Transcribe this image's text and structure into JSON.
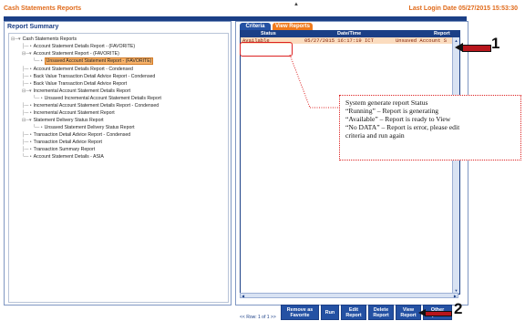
{
  "header": {
    "title": "Cash Statements Reports",
    "last_login": "Last Login Date 05/27/2015 15:53:30"
  },
  "report_summary": {
    "title": "Report Summary",
    "tree": [
      {
        "label": "Cash Statements Reports"
      },
      {
        "label": "Account Statement Details Report - (FAVORITE)"
      },
      {
        "label": "Account Statement Report - (FAVORITE)"
      },
      {
        "label": "Unsaved Account Statement Report - (FAVORITE)",
        "selected": true
      },
      {
        "label": "Account Statement Details Report - Condensed"
      },
      {
        "label": "Back Value Transaction Detail Advice Report - Condensed"
      },
      {
        "label": "Back Value Transaction Detail Advice Report"
      },
      {
        "label": "Incremental Account Statement Details Report"
      },
      {
        "label": "Unsaved Incremental Account Statement Details Report"
      },
      {
        "label": "Incremental Account Statement Details Report - Condensed"
      },
      {
        "label": "Incremental Account Statement Report"
      },
      {
        "label": "Statement Delivery Status Report"
      },
      {
        "label": "Unsaved Statement Delivery Status Report"
      },
      {
        "label": "Transaction Detail Advice Report - Condensed"
      },
      {
        "label": "Transaction Detail Advice Report"
      },
      {
        "label": "Transaction Summary Report"
      },
      {
        "label": "Account Statement Details - ASIA"
      }
    ]
  },
  "tabs": {
    "criteria": "Criteria",
    "view_reports": "View Reports"
  },
  "grid": {
    "columns": [
      "Status",
      "Date/Time",
      "Report"
    ],
    "rows": [
      {
        "status": "Available",
        "datetime": "05/27/2015 16:17:19 ICT",
        "report": "Unsaved Account S"
      }
    ],
    "row_count": "<< Row: 1 of 1 >>"
  },
  "annotation": {
    "lines": [
      "System generate report Status",
      "“Running” – Report is generating",
      "“Available” – Report is ready to View",
      "“No DATA” – Report is error, please edit",
      "criteria and run again"
    ],
    "marker1": "1",
    "marker2": "2"
  },
  "toolbar": {
    "remove_favorite": "Remove as Favorite",
    "run": "Run",
    "edit_report": "Edit Report",
    "delete_report": "Delete Report",
    "view_report": "View Report",
    "other_options": "Other Options"
  },
  "colors": {
    "brand_blue": "#1b3f86",
    "accent_orange": "#f07a1c",
    "highlight_red": "#d22222"
  }
}
